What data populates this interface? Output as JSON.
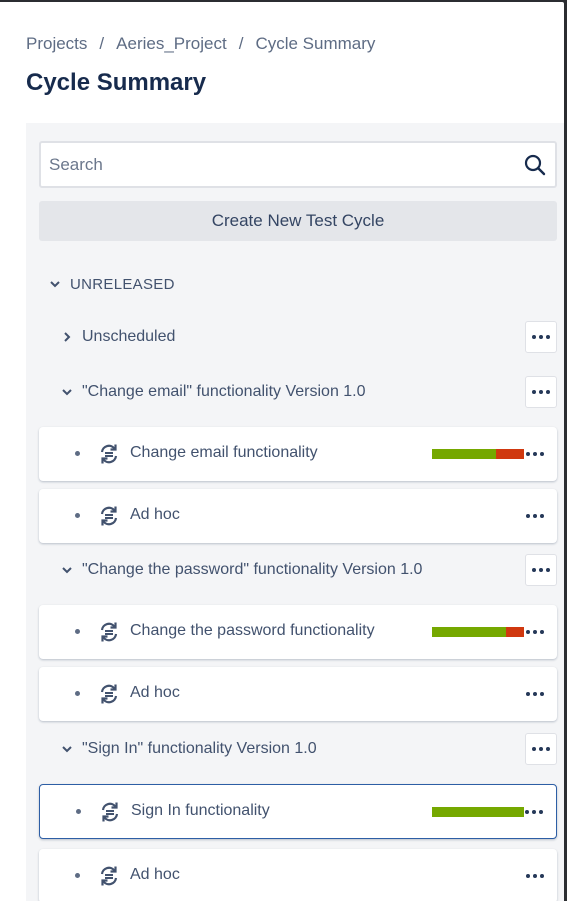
{
  "breadcrumb": {
    "items": [
      "Projects",
      "Aeries_Project",
      "Cycle Summary"
    ],
    "separator": "/"
  },
  "page_title": "Cycle Summary",
  "search": {
    "placeholder": "Search",
    "value": ""
  },
  "create_button_label": "Create New Test Cycle",
  "tree": {
    "root_label": "UNRELEASED",
    "unscheduled_label": "Unscheduled",
    "versions": [
      {
        "label": "\"Change email\" functionality Version 1.0",
        "cycles": [
          {
            "name": "Change email functionality",
            "pass_fraction": 0.7,
            "fail_fraction": 0.3
          },
          {
            "name": "Ad hoc"
          }
        ]
      },
      {
        "label": "\"Change the password\" functionality Version 1.0",
        "cycles": [
          {
            "name": "Change the password functionality",
            "pass_fraction": 0.8,
            "fail_fraction": 0.2
          },
          {
            "name": "Ad hoc"
          }
        ]
      },
      {
        "label": "\"Sign In\" functionality Version 1.0",
        "cycles": [
          {
            "name": "Sign In functionality",
            "pass_fraction": 1.0,
            "fail_fraction": 0.0,
            "selected": true
          },
          {
            "name": "Ad hoc"
          }
        ]
      }
    ]
  },
  "colors": {
    "pass": "#75a800",
    "fail": "#d0380f",
    "selected_border": "#2d5ea5"
  },
  "icons": {
    "search": "search-icon",
    "cycle": "test-cycle-icon",
    "more": "more-options-icon",
    "chevron_down": "chevron-down-icon",
    "chevron_right": "chevron-right-icon"
  }
}
